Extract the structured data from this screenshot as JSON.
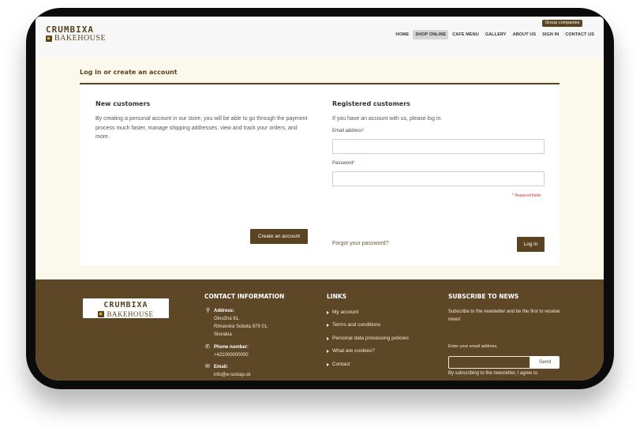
{
  "header": {
    "logo_top": "CRUMBIXA",
    "logo_bottom": "BAKEHOUSE",
    "group_button": "Group companies",
    "nav": [
      {
        "label": "HOME"
      },
      {
        "label": "SHOP ONLINE",
        "active": true
      },
      {
        "label": "CAFE MENU"
      },
      {
        "label": "GALLERY"
      },
      {
        "label": "ABOUT US"
      },
      {
        "label": "SIGN IN"
      },
      {
        "label": "CONTACT US"
      }
    ]
  },
  "page": {
    "title": "Log in or create an account",
    "new_customers": {
      "title": "New customers",
      "text": "By creating a personal account in our store, you will be able to go through the payment process much faster, manage shipping addresses, view and track your orders, and more.",
      "button": "Create an account"
    },
    "registered": {
      "title": "Registered customers",
      "intro": "If you have an account with us, please log in.",
      "email_label": "Email address",
      "password_label": "Password",
      "required_mark": "*",
      "required_note": "* Required fields",
      "email_value": "",
      "password_value": "",
      "forgot": "Forgot your password?",
      "login_button": "Log in"
    }
  },
  "footer": {
    "logo_top": "CRUMBIXA",
    "logo_bottom": "BAKEHOUSE",
    "contact": {
      "title": "CONTACT INFORMATION",
      "address_label": "Address:",
      "address_lines": [
        "Okružná 61,",
        "Rimavská Sobota 979 01,",
        "Slovakia"
      ],
      "phone_label": "Phone number:",
      "phone": "+421000000000",
      "email_label": "Email:",
      "email": "info@e-sostap.sk"
    },
    "links": {
      "title": "LINKS",
      "items": [
        "My account",
        "Terms and conditions",
        "Personal data processing policies",
        "What are cookies?",
        "Contact"
      ]
    },
    "newsletter": {
      "title": "SUBSCRIBE TO NEWS",
      "text": "Subscribe to the newsletter and be the first to receive news!",
      "email_label": "Enter your email address.",
      "email_value": "",
      "send": "Send",
      "consent": "By subscribing to the newsletter, I agree to"
    }
  },
  "colors": {
    "brand_brown": "#5a4321",
    "footer_brown": "#5e4726",
    "page_cream": "#fbf8ec",
    "required_red": "#c0392b"
  }
}
